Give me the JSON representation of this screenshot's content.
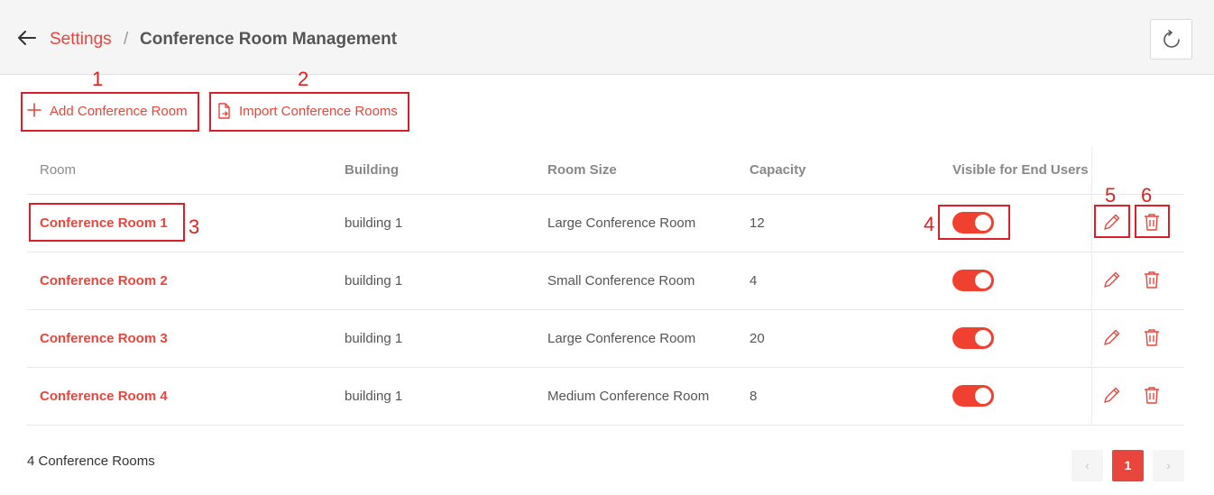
{
  "header": {
    "breadcrumb_parent": "Settings",
    "breadcrumb_separator": "/",
    "title": "Conference Room Management"
  },
  "toolbar": {
    "add_label": "Add Conference Room",
    "import_label": "Import Conference Rooms"
  },
  "table": {
    "columns": [
      "Room",
      "Building",
      "Room Size",
      "Capacity",
      "Visible for End Users"
    ],
    "rows": [
      {
        "room": "Conference Room 1",
        "building": "building 1",
        "size": "Large Conference Room",
        "capacity": "12",
        "visible": true
      },
      {
        "room": "Conference Room 2",
        "building": "building 1",
        "size": "Small Conference Room",
        "capacity": "4",
        "visible": true
      },
      {
        "room": "Conference Room 3",
        "building": "building 1",
        "size": "Large Conference Room",
        "capacity": "20",
        "visible": true
      },
      {
        "room": "Conference Room 4",
        "building": "building 1",
        "size": "Medium Conference Room",
        "capacity": "8",
        "visible": true
      }
    ]
  },
  "footer": {
    "count_text": "4 Conference Rooms",
    "current_page": "1",
    "prev_glyph": "‹",
    "next_glyph": "›"
  },
  "annotations": [
    "1",
    "2",
    "3",
    "4",
    "5",
    "6"
  ],
  "colors": {
    "accent": "#e8453c",
    "annotation": "#e02020",
    "toggle_on": "#f0402f"
  },
  "icons": [
    "back-arrow-icon",
    "refresh-icon",
    "plus-icon",
    "import-file-icon",
    "pencil-icon",
    "trash-icon"
  ]
}
